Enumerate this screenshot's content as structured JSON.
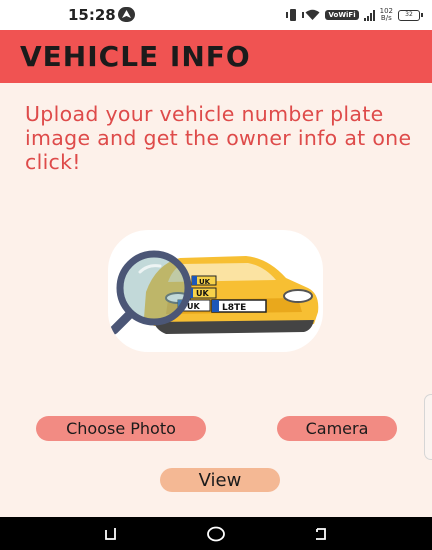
{
  "status_bar": {
    "time": "15:28",
    "network_badge": "VoWiFi",
    "speed_value": "102",
    "speed_unit": "B/s",
    "battery_level": "32"
  },
  "app_bar": {
    "title": "VEHICLE INFO"
  },
  "main": {
    "intro_text": "Upload your vehicle number plate image and get the owner info at one click!",
    "illustration": {
      "icon": "car-magnifier-icon",
      "plates": [
        "UK",
        "UK",
        "UK",
        "L8TE"
      ]
    },
    "buttons": {
      "choose_photo": "Choose Photo",
      "camera": "Camera",
      "view": "View"
    }
  },
  "nav_bar": {
    "icons": [
      "recent-apps-icon",
      "home-icon",
      "back-icon"
    ]
  },
  "colors": {
    "app_bar": "#f05352",
    "background": "#fdf1ea",
    "intro_text": "#de4b4a",
    "button": "#f28b83",
    "view_button": "#f4b894"
  }
}
